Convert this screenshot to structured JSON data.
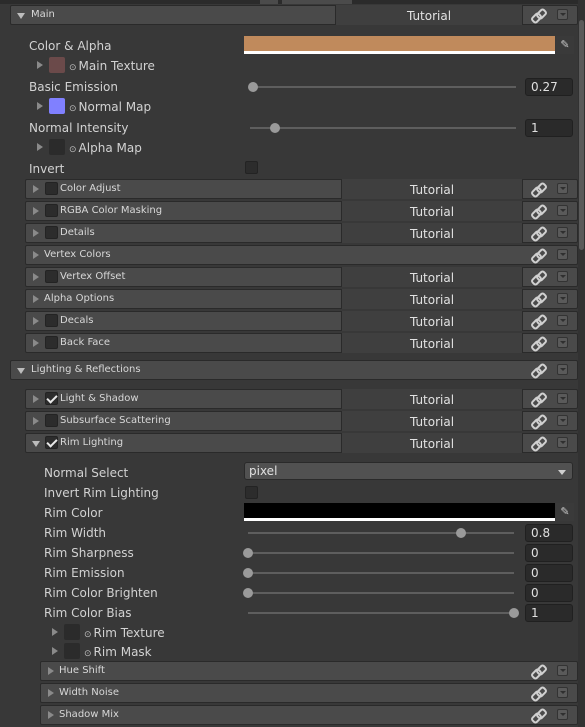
{
  "top": {
    "title": "Main",
    "tutorial": "Tutorial"
  },
  "main_props": {
    "color_alpha": "Color & Alpha",
    "color_alpha_value": "#c08a5c",
    "main_texture": "Main Texture",
    "basic_emission": "Basic Emission",
    "basic_emission_value": "0.27",
    "normal_map": "Normal Map",
    "normal_intensity": "Normal Intensity",
    "normal_intensity_value": "1",
    "alpha_map": "Alpha Map",
    "invert": "Invert"
  },
  "sections1": [
    {
      "label": "Color Adjust",
      "checkbox": true,
      "checked": false,
      "tutorial": "Tutorial"
    },
    {
      "label": "RGBA Color Masking",
      "checkbox": true,
      "checked": false,
      "tutorial": "Tutorial"
    },
    {
      "label": "Details",
      "checkbox": true,
      "checked": false,
      "tutorial": "Tutorial"
    },
    {
      "label": "Vertex Colors",
      "checkbox": false,
      "checked": false,
      "tutorial": ""
    },
    {
      "label": "Vertex Offset",
      "checkbox": true,
      "checked": false,
      "tutorial": "Tutorial"
    },
    {
      "label": "Alpha Options",
      "checkbox": false,
      "checked": false,
      "tutorial": "Tutorial"
    },
    {
      "label": "Decals",
      "checkbox": true,
      "checked": false,
      "tutorial": "Tutorial"
    },
    {
      "label": "Back Face",
      "checkbox": true,
      "checked": false,
      "tutorial": "Tutorial"
    }
  ],
  "lighting": {
    "title": "Lighting & Reflections"
  },
  "sections2": [
    {
      "label": "Light & Shadow",
      "checked": true,
      "tutorial": "Tutorial"
    },
    {
      "label": "Subsurface Scattering",
      "checked": false,
      "tutorial": "Tutorial"
    },
    {
      "label": "Rim Lighting",
      "checked": true,
      "tutorial": "Tutorial"
    }
  ],
  "rim": {
    "normal_select": "Normal Select",
    "normal_select_value": "pixel",
    "invert_rim": "Invert Rim Lighting",
    "rim_color": "Rim Color",
    "rim_color_value": "#000000",
    "rim_width": "Rim Width",
    "rim_width_value": "0.8",
    "rim_width_frac": 0.8,
    "rim_sharpness": "Rim Sharpness",
    "rim_sharpness_value": "0",
    "rim_sharpness_frac": 0,
    "rim_emission": "Rim Emission",
    "rim_emission_value": "0",
    "rim_emission_frac": 0,
    "rim_brighten": "Rim Color Brighten",
    "rim_brighten_value": "0",
    "rim_brighten_frac": 0,
    "rim_bias": "Rim Color Bias",
    "rim_bias_value": "1",
    "rim_bias_frac": 1,
    "rim_texture": "Rim Texture",
    "rim_mask": "Rim Mask"
  },
  "sections3": [
    {
      "label": "Hue Shift"
    },
    {
      "label": "Width Noise"
    },
    {
      "label": "Shadow Mix"
    }
  ]
}
